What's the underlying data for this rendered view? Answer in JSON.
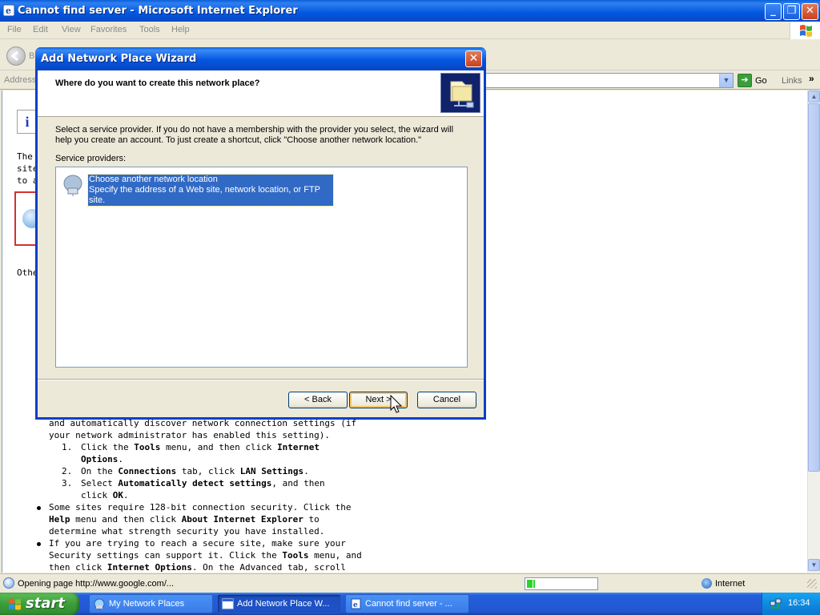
{
  "browser": {
    "title": "Cannot find server - Microsoft Internet Explorer",
    "menu": [
      "File",
      "Edit",
      "View",
      "Favorites",
      "Tools",
      "Help"
    ],
    "back_label": "B",
    "address_label": "Address",
    "go_label": "Go",
    "links_label": "Links",
    "links_chevron": "»"
  },
  "page": {
    "partial_lines": [
      "The",
      "site",
      "to a",
      "Othe"
    ],
    "body_lines": [
      "and automatically discover network connection settings (if",
      "your network administrator has enabled this setting)."
    ],
    "steps": [
      {
        "num": "1.",
        "lines": [
          [
            {
              "t": "Click the "
            },
            {
              "t": "Tools",
              "b": true
            },
            {
              "t": " menu, and then click "
            },
            {
              "t": "Internet",
              "b": true
            }
          ],
          [
            {
              "t": "Options",
              "b": true
            },
            {
              "t": "."
            }
          ]
        ]
      },
      {
        "num": "2.",
        "lines": [
          [
            {
              "t": "On the "
            },
            {
              "t": "Connections",
              "b": true
            },
            {
              "t": " tab, click "
            },
            {
              "t": "LAN Settings",
              "b": true
            },
            {
              "t": "."
            }
          ]
        ]
      },
      {
        "num": "3.",
        "lines": [
          [
            {
              "t": "Select "
            },
            {
              "t": "Automatically detect settings",
              "b": true
            },
            {
              "t": ", and then"
            }
          ],
          [
            {
              "t": "click "
            },
            {
              "t": "OK",
              "b": true
            },
            {
              "t": "."
            }
          ]
        ]
      }
    ],
    "bullets": [
      {
        "lines": [
          [
            {
              "t": "Some sites require 128-bit connection security. Click the"
            }
          ],
          [
            {
              "t": "Help",
              "b": true
            },
            {
              "t": " menu and then click "
            },
            {
              "t": "About Internet Explorer",
              "b": true
            },
            {
              "t": " to"
            }
          ],
          [
            {
              "t": "determine what strength security you have installed."
            }
          ]
        ]
      },
      {
        "lines": [
          [
            {
              "t": "If you are trying to reach a secure site, make sure your"
            }
          ],
          [
            {
              "t": "Security settings can support it. Click the "
            },
            {
              "t": "Tools",
              "b": true
            },
            {
              "t": " menu, and"
            }
          ],
          [
            {
              "t": "then click "
            },
            {
              "t": "Internet Options",
              "b": true
            },
            {
              "t": ". On the Advanced tab, scroll"
            }
          ]
        ]
      }
    ]
  },
  "statusbar": {
    "text": "Opening page http://www.google.com/...",
    "progress": 0.12,
    "zone": "Internet"
  },
  "dialog": {
    "title": "Add Network Place Wizard",
    "heading": "Where do you want to create this network place?",
    "description": "Select a service provider.  If you do not have a membership with the provider you select, the wizard will help you create an account.  To just create a shortcut, click \"Choose another network location.\"",
    "providers_label": "Service providers:",
    "providers": [
      {
        "name": "Choose another network location",
        "detail": "Specify the address of a Web site, network location, or FTP site."
      }
    ],
    "back_label": "< Back",
    "next_label": "Next >",
    "cancel_label": "Cancel"
  },
  "taskbar": {
    "start_label": "start",
    "tasks": [
      {
        "label": "My Network Places"
      },
      {
        "label": "Add Network Place W..."
      },
      {
        "label": "Cannot find server - ..."
      }
    ],
    "clock": "16:34"
  },
  "colors": {
    "selection": "#316ac5",
    "titlebar": "#0058e0",
    "taskbar": "#245edb",
    "start": "#3c9d3b"
  }
}
